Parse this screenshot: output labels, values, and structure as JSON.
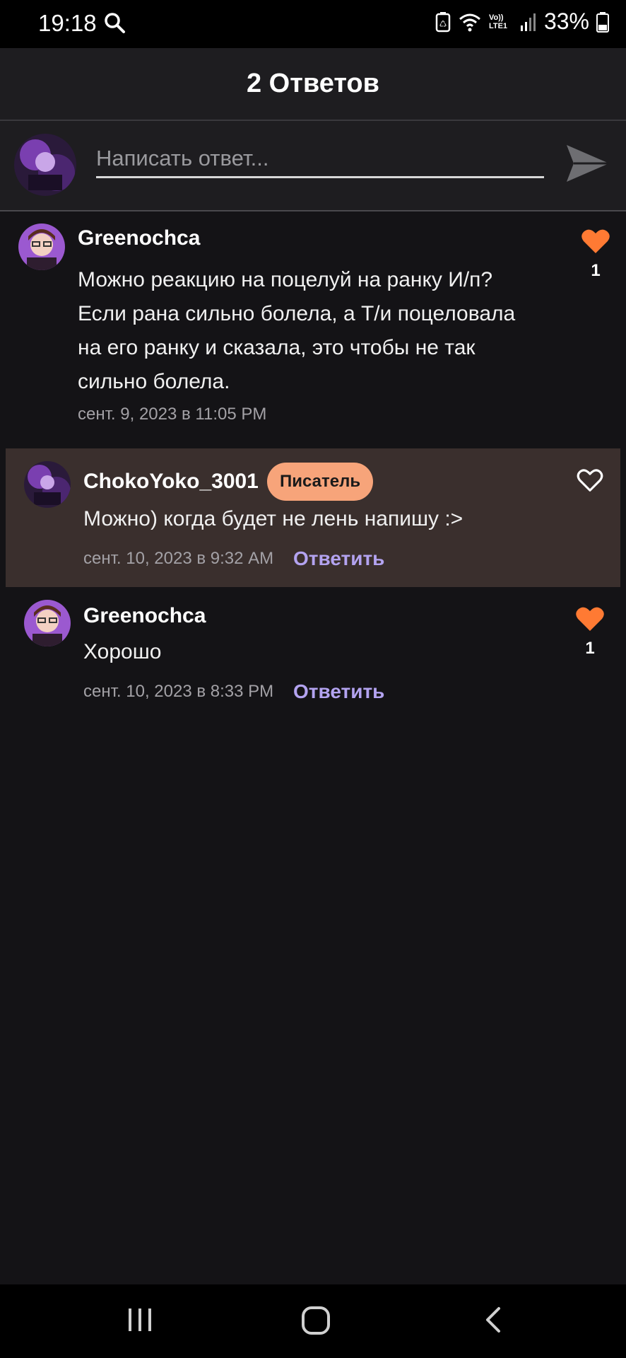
{
  "status_bar": {
    "time": "19:18",
    "battery_percent": "33%",
    "network_label": "Vo)) LTE1"
  },
  "header": {
    "title": "2 Ответов"
  },
  "composer": {
    "placeholder": "Написать ответ...",
    "send_icon": "send-icon"
  },
  "comments": [
    {
      "username": "Greenochca",
      "lines": [
        "Можно реакцию на поцелуй на ранку И/п?",
        "Если рана сильно болела, а Т/и поцеловала",
        "на его ранку и сказала, это чтобы не так",
        "сильно болела."
      ],
      "timestamp": "сент. 9, 2023 в 11:05 PM",
      "likes": "1",
      "liked": true
    },
    {
      "username": "ChokoYoko_3001",
      "badge": "Писатель",
      "text": "Можно) когда будет не лень напишу :>",
      "timestamp": "сент. 10, 2023 в 9:32 AM",
      "reply_label": "Ответить",
      "liked": false
    },
    {
      "username": "Greenochca",
      "text": "Хорошо",
      "timestamp": "сент. 10, 2023 в 8:33 PM",
      "reply_label": "Ответить",
      "likes": "1",
      "liked": true
    }
  ],
  "colors": {
    "accent_heart": "#ff7a33",
    "badge_bg": "#f7a47a",
    "reply_link": "#b3a3f0",
    "highlight_bg": "#3a2f2d"
  }
}
